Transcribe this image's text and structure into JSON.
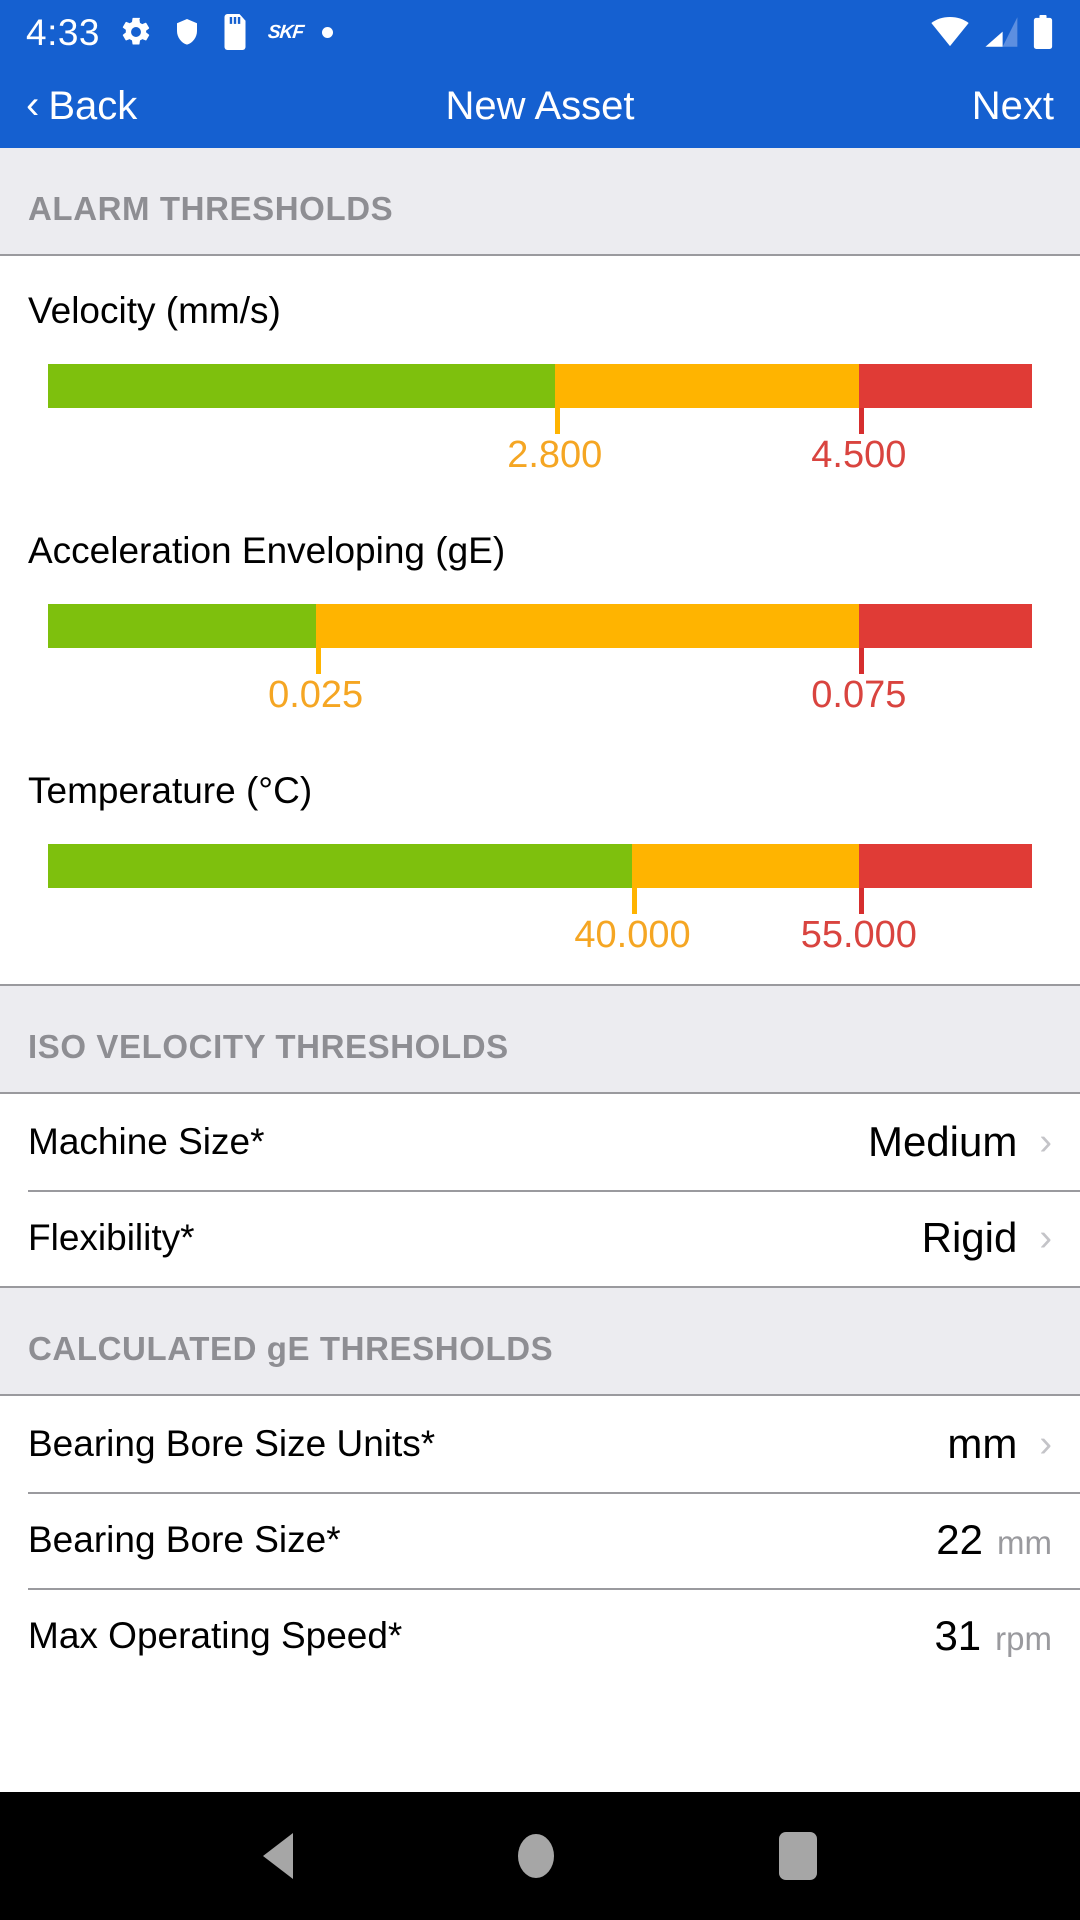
{
  "statusbar": {
    "time": "4:33",
    "icons": [
      "gear-icon",
      "shield-icon",
      "sd-card-icon",
      "skf-logo",
      "dot-icon"
    ],
    "brand_text": "SKF",
    "right_icons": [
      "wifi-icon",
      "cellular-signal-icon",
      "battery-icon"
    ]
  },
  "navbar": {
    "back_label": "Back",
    "back_chevron": "‹",
    "title": "New Asset",
    "next_label": "Next"
  },
  "sections": {
    "alarm_thresholds": "ALARM THRESHOLDS",
    "iso_velocity": "ISO VELOCITY THRESHOLDS",
    "calculated_ge": "CALCULATED gE THRESHOLDS"
  },
  "colors": {
    "brand_blue": "#1560d0",
    "green": "#7ec00d",
    "amber": "#ffb400",
    "red": "#e03b36",
    "warn_text": "#f5a623",
    "alarm_text": "#d9443f",
    "section_bg": "#ececf0",
    "section_text": "#8e8e93"
  },
  "chart_data": [
    {
      "type": "bar",
      "title": "Velocity (mm/s)",
      "warning_value": "2.800",
      "alarm_value": "4.500",
      "green_pct": 51.5,
      "amber_pct": 30.9,
      "red_pct": 17.6
    },
    {
      "type": "bar",
      "title": "Acceleration Enveloping (gE)",
      "warning_value": "0.025",
      "alarm_value": "0.075",
      "green_pct": 27.2,
      "amber_pct": 55.2,
      "red_pct": 17.6
    },
    {
      "type": "bar",
      "title": "Temperature (°C)",
      "warning_value": "40.000",
      "alarm_value": "55.000",
      "green_pct": 59.4,
      "amber_pct": 23.0,
      "red_pct": 17.6
    }
  ],
  "iso_rows": [
    {
      "label": "Machine Size*",
      "value": "Medium",
      "unit": "",
      "chevron": "›"
    },
    {
      "label": "Flexibility*",
      "value": "Rigid",
      "unit": "",
      "chevron": "›"
    }
  ],
  "ge_rows": [
    {
      "label": "Bearing Bore Size Units*",
      "value": "mm",
      "unit": "",
      "chevron": "›"
    },
    {
      "label": "Bearing Bore Size*",
      "value": "22",
      "unit": "mm",
      "chevron": ""
    },
    {
      "label": "Max Operating Speed*",
      "value": "31",
      "unit": "rpm",
      "chevron": ""
    }
  ],
  "androidnav": {
    "back": "back-triangle",
    "home": "home-circle",
    "recents": "recents-square"
  }
}
